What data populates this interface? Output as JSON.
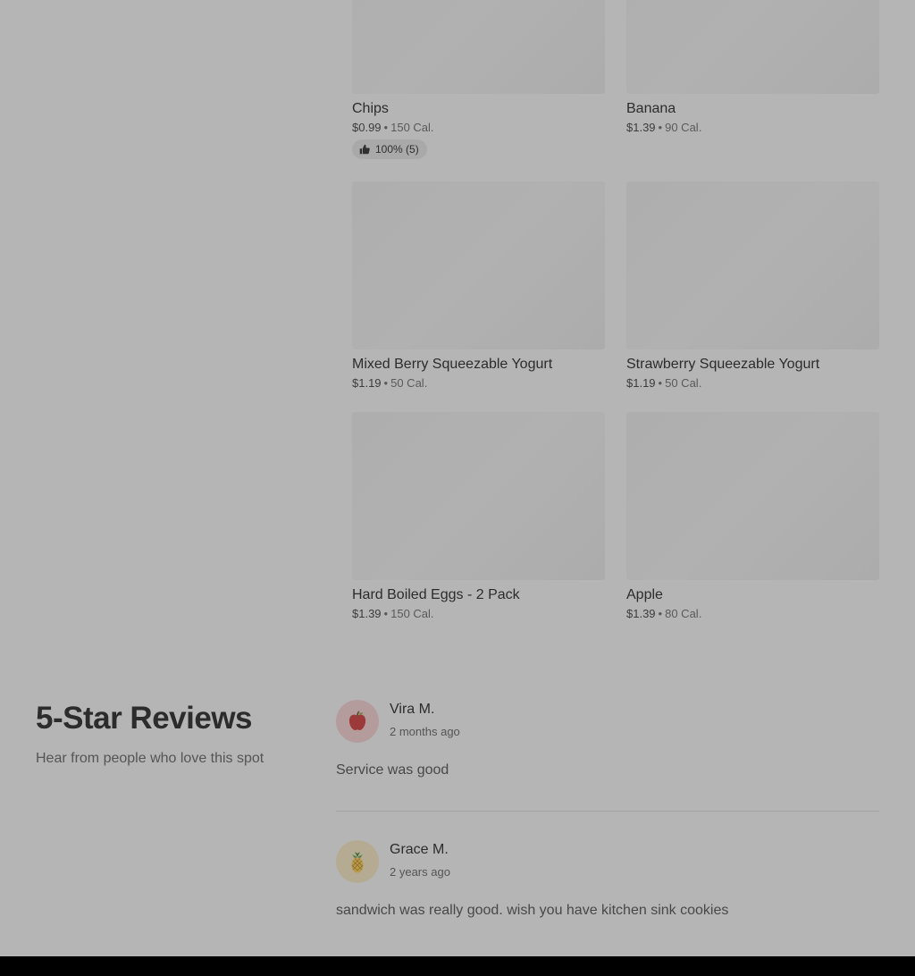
{
  "menu_items": [
    {
      "name": "Chips",
      "price": "$0.99",
      "calories": "150 Cal.",
      "rating": "100% (5)"
    },
    {
      "name": "Banana",
      "price": "$1.39",
      "calories": "90 Cal."
    },
    {
      "name": "Mixed Berry Squeezable Yogurt",
      "price": "$1.19",
      "calories": "50 Cal."
    },
    {
      "name": "Strawberry Squeezable Yogurt",
      "price": "$1.19",
      "calories": "50 Cal."
    },
    {
      "name": "Hard Boiled Eggs - 2 Pack",
      "price": "$1.39",
      "calories": "150 Cal."
    },
    {
      "name": "Apple",
      "price": "$1.39",
      "calories": "80 Cal."
    }
  ],
  "separator": "•",
  "reviews_section": {
    "title": "5-Star Reviews",
    "subtitle": "Hear from people who love this spot",
    "reviews": [
      {
        "name": "Vira M.",
        "time": "2 months ago",
        "text": "Service was good",
        "avatar_icon": "apple-icon"
      },
      {
        "name": "Grace M.",
        "time": "2 years ago",
        "text": "sandwich was really good. wish you have kitchen sink cookies",
        "avatar_icon": "pineapple-icon"
      }
    ]
  },
  "colors": {
    "background": "#b5b5b5",
    "thumb": "#afafaf",
    "badge": "#a9a9a9",
    "footer": "#000000"
  }
}
